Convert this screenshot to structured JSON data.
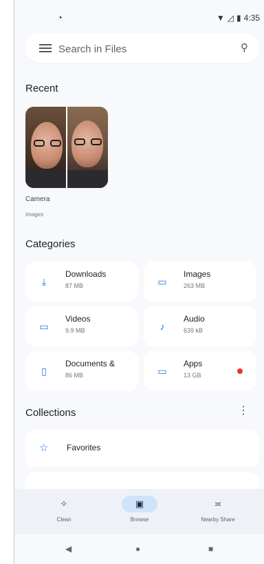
{
  "status": {
    "left_icon": "sync-icon",
    "time": "4:35"
  },
  "search": {
    "placeholder": "Search in Files"
  },
  "recent": {
    "title": "Recent",
    "item_label": "Camera",
    "item_sub": "Images"
  },
  "categories": {
    "title": "Categories",
    "items": [
      {
        "name": "Downloads",
        "size": "87 MB",
        "icon": "download-icon"
      },
      {
        "name": "Images",
        "size": "263 MB",
        "icon": "image-icon"
      },
      {
        "name": "Videos",
        "size": "9.9 MB",
        "icon": "video-icon"
      },
      {
        "name": "Audio",
        "size": "639 kB",
        "icon": "music-note-icon"
      },
      {
        "name": "Documents &",
        "size": "86 MB",
        "icon": "document-icon"
      },
      {
        "name": "Apps",
        "size": "13 GB",
        "icon": "apps-icon"
      }
    ]
  },
  "collections": {
    "title": "Collections",
    "favorites": "Favorites"
  },
  "bottom_nav": {
    "clean": "Clean",
    "browse": "Browse",
    "nearby": "Nearby Share"
  },
  "colors": {
    "accent": "#1a73e8",
    "badge": "#e53935",
    "active_pill": "#cfe3fb"
  }
}
